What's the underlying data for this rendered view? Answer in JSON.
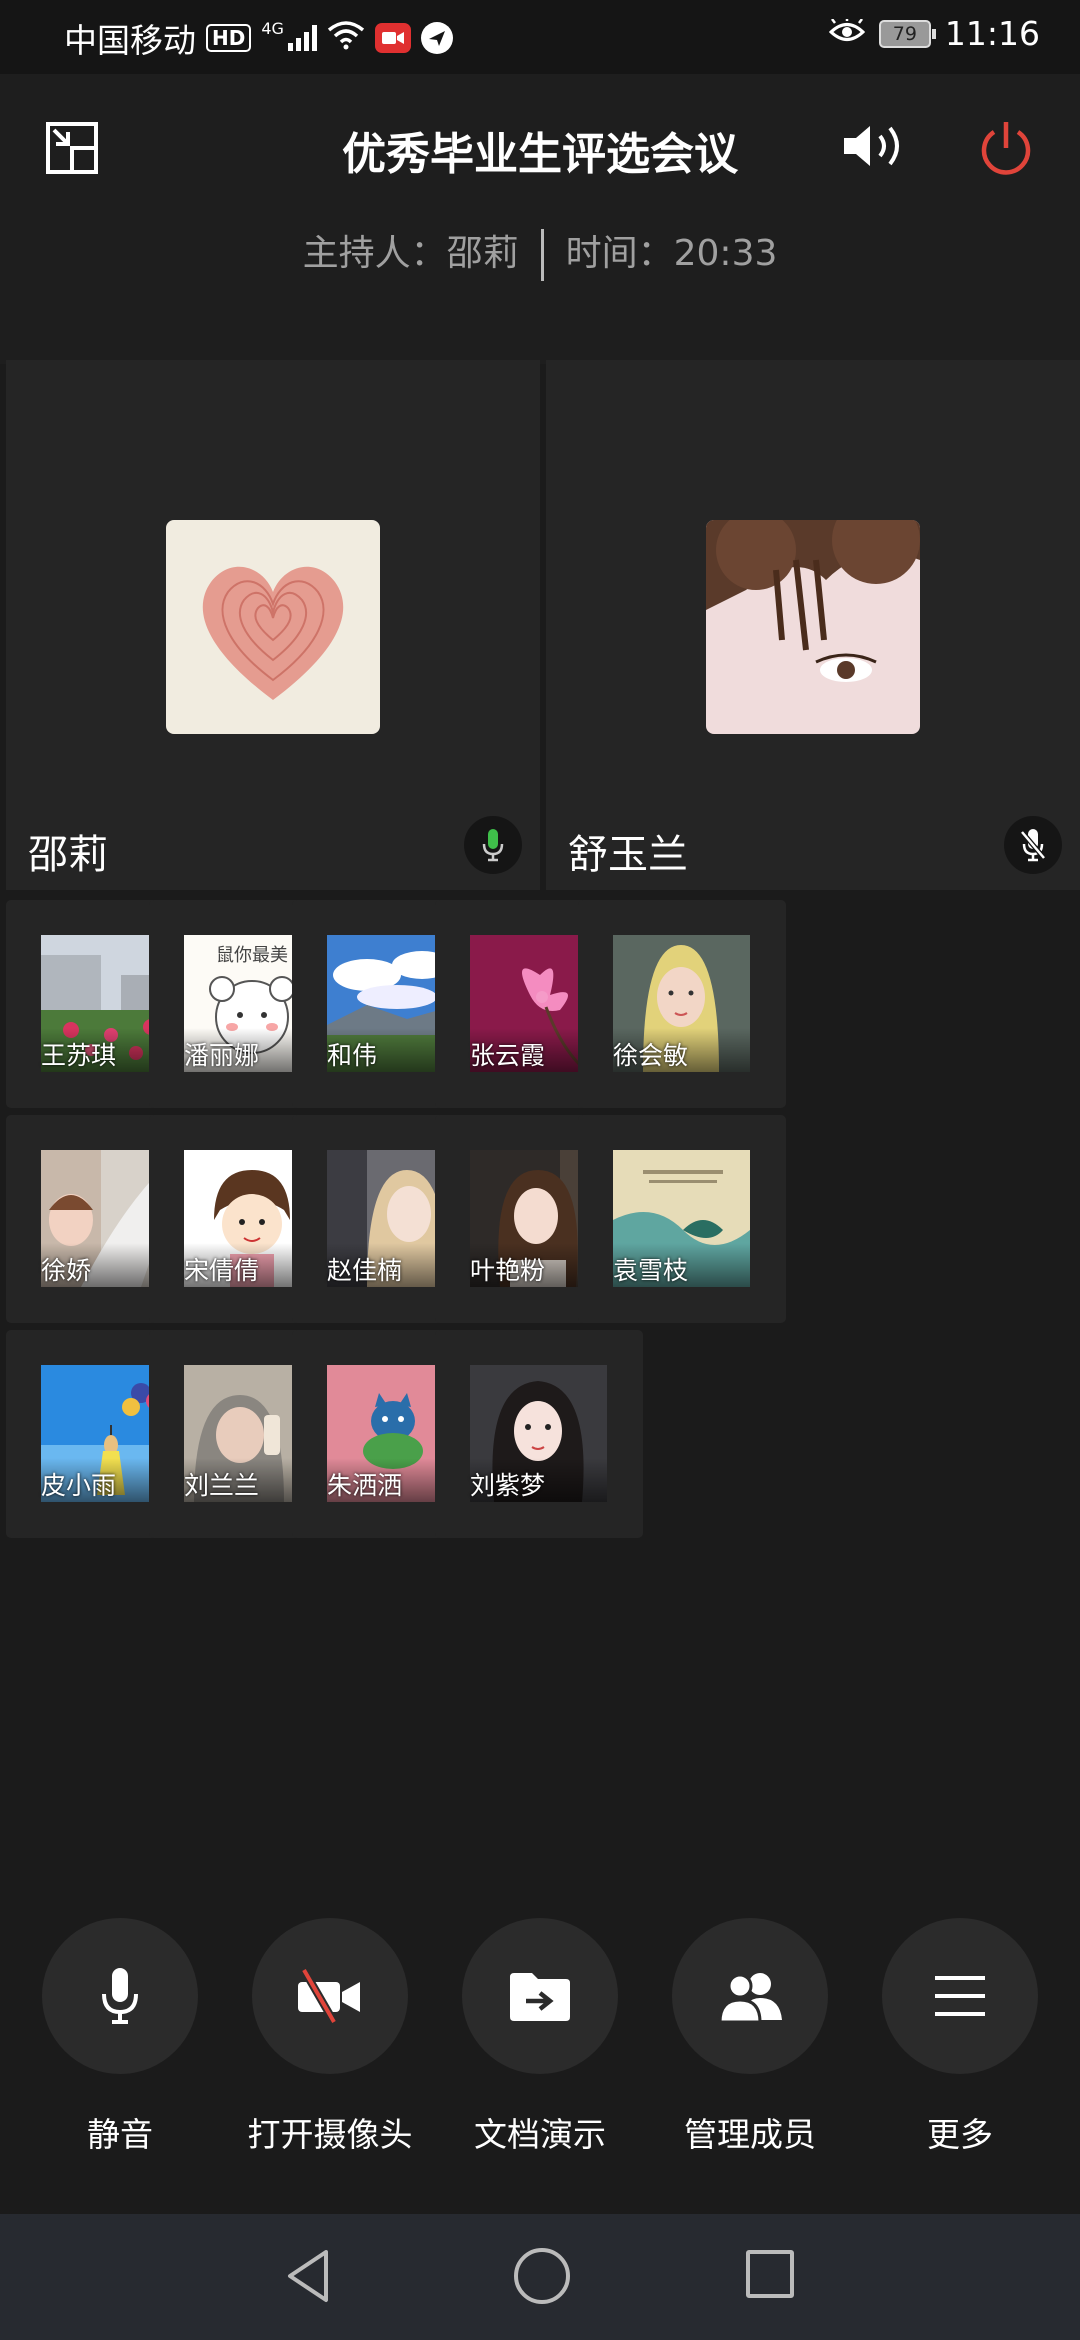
{
  "status_bar": {
    "carrier": "中国移动",
    "hd": "HD",
    "network": "4G",
    "battery": "79",
    "time": "11:16"
  },
  "header": {
    "title": "优秀毕业生评选会议",
    "host_label": "主持人：邵莉",
    "time_label": "时间：20:33"
  },
  "main_participants": [
    {
      "name": "邵莉",
      "mic": "on"
    },
    {
      "name": "舒玉兰",
      "mic": "muted"
    }
  ],
  "participants": [
    {
      "name": "王苏琪"
    },
    {
      "name": "潘丽娜"
    },
    {
      "name": "和伟"
    },
    {
      "name": "张云霞"
    },
    {
      "name": "徐会敏"
    },
    {
      "name": "徐娇"
    },
    {
      "name": "宋倩倩"
    },
    {
      "name": "赵佳楠"
    },
    {
      "name": "叶艳粉"
    },
    {
      "name": "袁雪枝"
    },
    {
      "name": "皮小雨"
    },
    {
      "name": "刘兰兰"
    },
    {
      "name": "朱洒洒"
    },
    {
      "name": "刘紫梦"
    }
  ],
  "controls": {
    "mute": "静音",
    "camera": "打开摄像头",
    "doc": "文档演示",
    "members": "管理成员",
    "more": "更多"
  },
  "colors": {
    "background": "#1b1b1b",
    "tile": "#252525",
    "power_red": "#e0443a",
    "mic_green": "#3fbf4a"
  }
}
